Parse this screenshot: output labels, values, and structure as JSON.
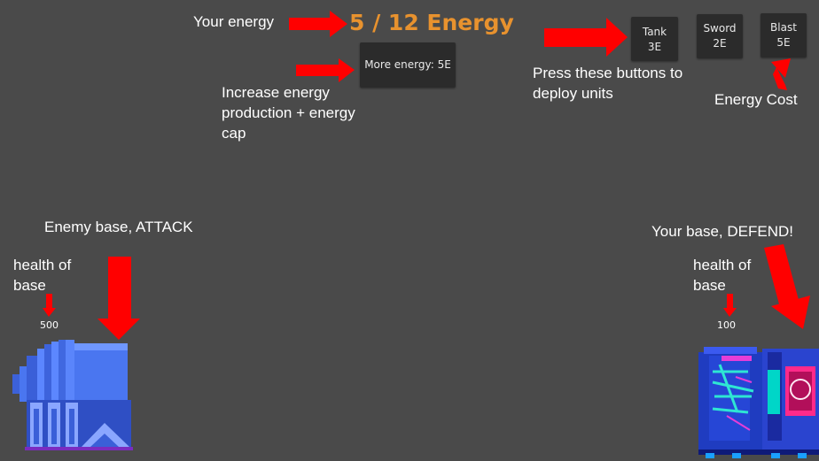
{
  "hud": {
    "energy_display": "5 / 12 Energy",
    "more_energy_button": "More energy: 5E"
  },
  "units": [
    {
      "name": "Tank",
      "cost": "3E"
    },
    {
      "name": "Sword",
      "cost": "2E"
    },
    {
      "name": "Blast",
      "cost": "5E"
    }
  ],
  "bases": {
    "enemy_health": "500",
    "player_health": "100"
  },
  "annotations": {
    "your_energy": "Your energy",
    "increase_energy_line1": "Increase energy",
    "increase_energy_line2": "production + energy",
    "increase_energy_line3": "cap",
    "press_buttons_line1": "Press these buttons to",
    "press_buttons_line2": "deploy units",
    "energy_cost": "Energy Cost",
    "enemy_base": "Enemy base, ATTACK",
    "your_base": "Your base, DEFEND!",
    "health_of_base_left_line1": "health of",
    "health_of_base_left_line2": "base",
    "health_of_base_right_line1": "health of",
    "health_of_base_right_line2": "base"
  },
  "colors": {
    "background": "#4a4a4a",
    "energy_text": "#e8922e",
    "arrow": "#ff0000",
    "button_bg": "#2b2b2b"
  }
}
